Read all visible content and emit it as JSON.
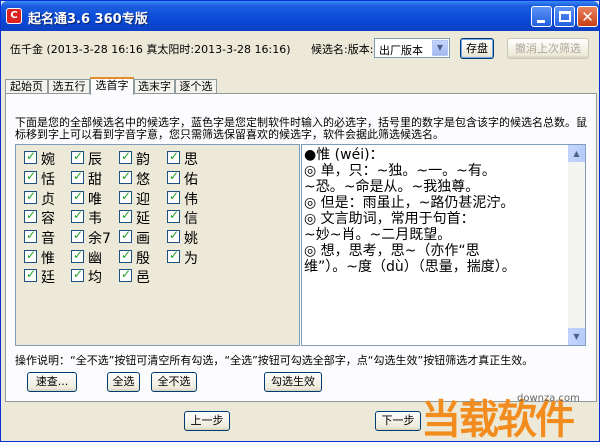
{
  "window": {
    "title": "起名通3.6 360专版",
    "app_icon_glyph": "C"
  },
  "info": {
    "person_line": "伍千金 (2013-3-28 16:16 真太阳时:2013-3-28 16:16)",
    "candidate_label": "候选名:版本:",
    "version_value": "出厂版本",
    "save_label": "存盘",
    "undo_label": "撤消上次筛选"
  },
  "tabs": [
    {
      "label": "起始页",
      "active": false
    },
    {
      "label": "选五行",
      "active": false
    },
    {
      "label": "选首字",
      "active": true
    },
    {
      "label": "选末字",
      "active": false
    },
    {
      "label": "逐个选",
      "active": false
    }
  ],
  "instructions": "下面是您的全部候选名中的候选字，蓝色字是您定制软件时输入的必选字，括号里的数字是包含该字的候选名总数。鼠标移到字上可以看到字音字意，您只需筛选保留喜欢的候选字，软件会据此筛选候选名。",
  "characters": [
    [
      "婉",
      "辰",
      "韵",
      "思"
    ],
    [
      "恬",
      "甜",
      "悠",
      "佑"
    ],
    [
      "贞",
      "唯",
      "迎",
      "伟"
    ],
    [
      "容",
      "韦",
      "延",
      "信"
    ],
    [
      "音",
      "余7",
      "画",
      "姚"
    ],
    [
      "惟",
      "幽",
      "殷",
      "为"
    ],
    [
      "廷",
      "均",
      "邑"
    ]
  ],
  "detail_lines": [
    "●惟 (wéi)：",
    "◎ 单，只：~独。~一。~有。",
    "~恐。~命是从。~我独尊。",
    "◎ 但是：雨虽止，~路仍甚泥泞。",
    "◎ 文言助词，常用于句首：",
    "~妙~肖。~二月既望。",
    "◎ 想，思考，思~（亦作“思",
    "维”）。~度（dù）（思量，揣度）。"
  ],
  "ops_note": "操作说明：“全不选”按钮可清空所有勾选，“全选”按钮可勾选全部字，点“勾选生效”按钮筛选才真正生效。",
  "buttons": {
    "quick": "速查...",
    "select_all": "全选",
    "select_none": "全不选",
    "apply": "勾选生效",
    "prev": "上一步",
    "next": "下一步"
  },
  "watermark": {
    "big": "当载软件",
    "small": "downza.com"
  },
  "colors": {
    "titlebar": "#0a4ad6",
    "active_tab_accent": "#e68b2c",
    "check": "#21a121",
    "watermark": "#f28c1e"
  }
}
